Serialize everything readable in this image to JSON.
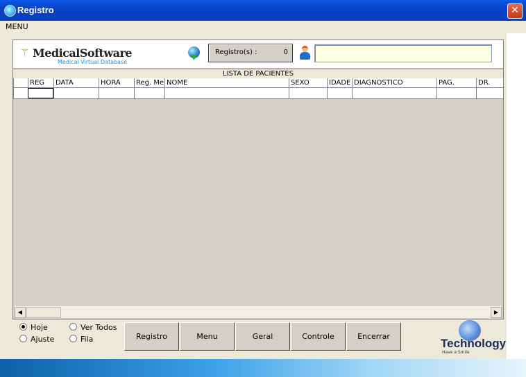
{
  "window": {
    "title": "Registro",
    "close_label": "✕"
  },
  "menu": {
    "label": "MENU"
  },
  "header": {
    "logo_name": "MedicalSoftware",
    "logo_sub": "Medical Virtual Database",
    "registros_label": "Registro(s) :",
    "registros_count": "0",
    "user_field_value": ""
  },
  "list": {
    "title": "LISTA DE PACIENTES",
    "columns": [
      "REG",
      "DATA",
      "HORA",
      "Reg. Me",
      "NOME",
      "SEXO",
      "IDADE",
      "DIAGNOSTICO",
      "PAG.",
      "DR."
    ]
  },
  "filters": {
    "hoje": "Hoje",
    "ajuste": "Ajuste",
    "ver_todos": "Ver Todos",
    "fila": "Fila",
    "selected": "Hoje"
  },
  "buttons": {
    "registro": "Registro",
    "menu": "Menu",
    "geral": "Geral",
    "controle": "Controle",
    "encerrar": "Encerrar"
  },
  "brand": {
    "name": "Technology",
    "slogan": "Have a Smile"
  },
  "icons": [
    "app-globe-icon",
    "globe-download-icon",
    "user-icon",
    "scroll-left-icon",
    "scroll-right-icon",
    "technology-logo-icon"
  ]
}
